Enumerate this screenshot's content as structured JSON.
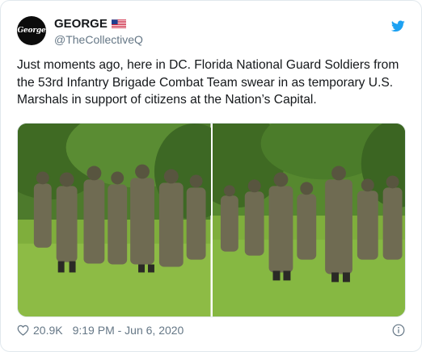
{
  "author": {
    "name": "GEORGE",
    "handle": "@TheCollectiveQ",
    "avatar_text": "George"
  },
  "tweet": {
    "text": "Just moments ago, here in DC. Florida National Guard Soldiers from the 53rd Infantry Brigade Combat Team swear in as temporary U.S. Marshals in support of citizens at the Nation’s Capital."
  },
  "footer": {
    "likes": "20.9K",
    "timestamp": "9:19 PM - Jun 6, 2020"
  },
  "icons": {
    "bird": "twitter-bird-icon",
    "heart": "heart-icon",
    "info": "info-icon",
    "flag": "us-flag-icon"
  },
  "colors": {
    "brand": "#1da1f2",
    "secondary_text": "#657786",
    "border": "#e1e8ed"
  }
}
